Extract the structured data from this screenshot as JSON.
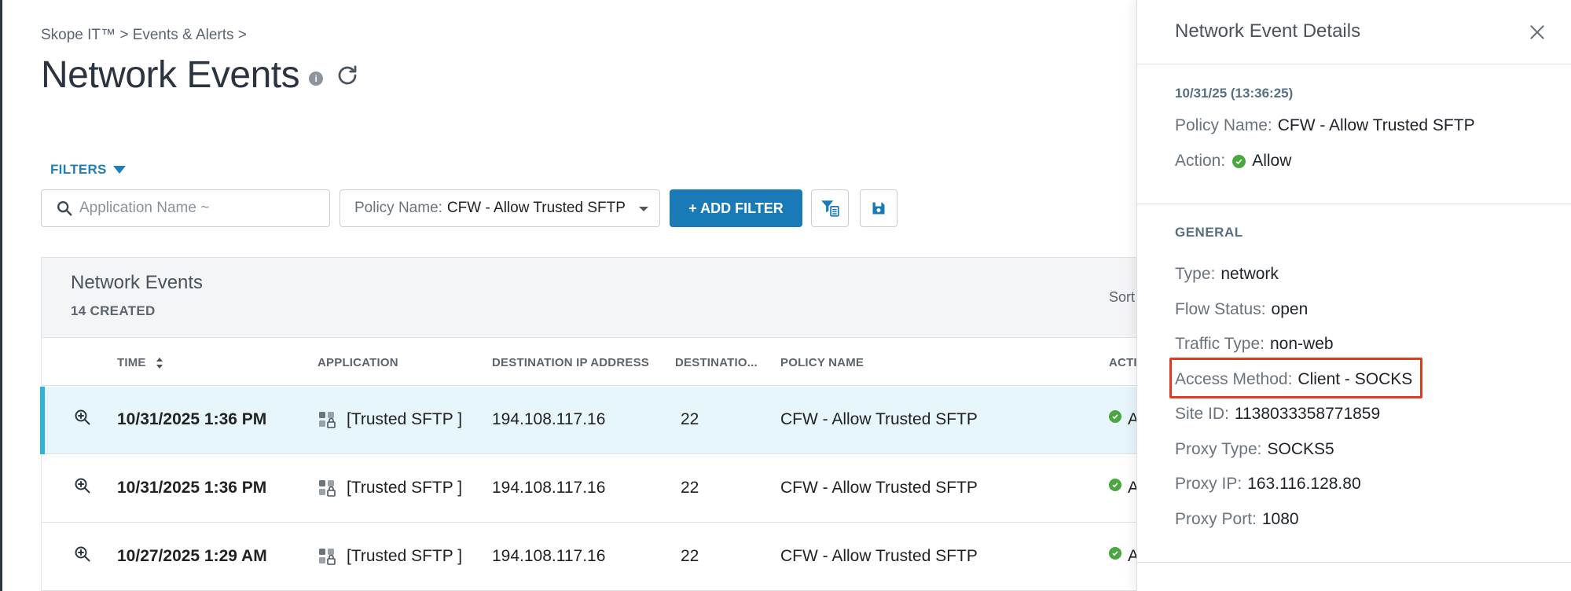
{
  "breadcrumb": "Skope IT™ > Events & Alerts >",
  "page_title": "Network Events",
  "info_icon_glyph": "i",
  "filters": {
    "toggle_label": "FILTERS",
    "search_placeholder": "Application Name ~",
    "policy_filter_label": "Policy Name:",
    "policy_filter_value": "CFW - Allow Trusted SFTP",
    "add_filter_label": "+ ADD FILTER"
  },
  "card": {
    "title": "Network Events",
    "count": "14 CREATED",
    "sort_label": "Sort"
  },
  "columns": {
    "time": "TIME",
    "application": "APPLICATION",
    "destination_ip": "DESTINATION IP ADDRESS",
    "destination_port": "DESTINATIO...",
    "policy_name": "POLICY NAME",
    "action": "ACTI"
  },
  "rows": [
    {
      "time": "10/31/2025 1:36 PM",
      "application": "[Trusted SFTP ]",
      "destination_ip": "194.108.117.16",
      "destination_port": "22",
      "policy_name": "CFW - Allow Trusted SFTP",
      "action": "A"
    },
    {
      "time": "10/31/2025 1:36 PM",
      "application": "[Trusted SFTP ]",
      "destination_ip": "194.108.117.16",
      "destination_port": "22",
      "policy_name": "CFW - Allow Trusted SFTP",
      "action": "A"
    },
    {
      "time": "10/27/2025 1:29 AM",
      "application": "[Trusted SFTP ]",
      "destination_ip": "194.108.117.16",
      "destination_port": "22",
      "policy_name": "CFW - Allow Trusted SFTP",
      "action": "A"
    }
  ],
  "details": {
    "title": "Network Event Details",
    "timestamp": "10/31/25 (13:36:25)",
    "policy_name_label": "Policy Name:",
    "policy_name_value": "CFW - Allow Trusted SFTP",
    "action_label": "Action:",
    "action_value": "Allow",
    "general_title": "GENERAL",
    "general": [
      {
        "label": "Type:",
        "value": "network"
      },
      {
        "label": "Flow Status:",
        "value": "open"
      },
      {
        "label": "Traffic Type:",
        "value": "non-web"
      },
      {
        "label": "Access Method:",
        "value": "Client - SOCKS"
      },
      {
        "label": "Site ID:",
        "value": "1138033358771859"
      },
      {
        "label": "Proxy Type:",
        "value": "SOCKS5"
      },
      {
        "label": "Proxy IP:",
        "value": "163.116.128.80"
      },
      {
        "label": "Proxy Port:",
        "value": "1080"
      }
    ]
  },
  "colors": {
    "accent": "#1a7ab7",
    "selected_row_bg": "#e6f6fb",
    "selected_row_bar": "#2bb5dd",
    "allow_green": "#4aa63e",
    "highlight_red": "#e03a25"
  },
  "icons": {
    "search": "search-icon",
    "refresh": "refresh-icon",
    "info": "info-icon",
    "filter_list": "filter-list-icon",
    "save": "save-icon",
    "zoom": "zoom-in-icon",
    "app": "app-grid-lock-icon",
    "close": "close-icon",
    "allow": "check-circle-icon"
  }
}
